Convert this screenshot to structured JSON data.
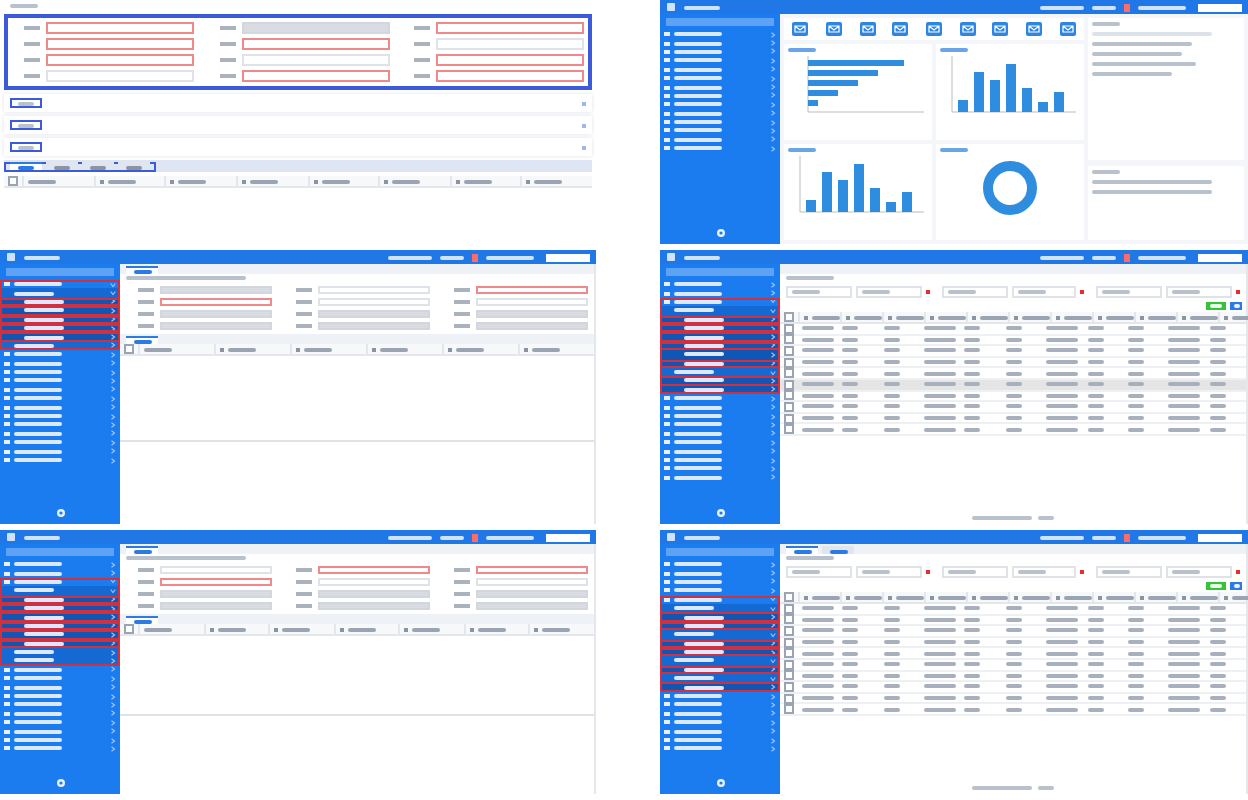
{
  "screens": [
    {
      "kind": "form",
      "fields": [
        {
          "required": true,
          "disabled": false
        },
        {
          "required": false,
          "disabled": true
        },
        {
          "required": true,
          "disabled": false
        },
        {
          "required": true,
          "disabled": false
        },
        {
          "required": true,
          "disabled": false
        },
        {
          "required": false,
          "disabled": false
        },
        {
          "required": true,
          "disabled": false
        },
        {
          "required": false,
          "disabled": false
        },
        {
          "required": true,
          "disabled": false
        },
        {
          "required": false,
          "disabled": false
        },
        {
          "required": true,
          "disabled": false
        },
        {
          "required": true,
          "disabled": false
        }
      ],
      "sections": [
        {
          "marked": true
        },
        {
          "marked": true
        },
        {
          "marked": true
        }
      ],
      "tabs": [
        {
          "selected": true
        },
        {
          "selected": false
        },
        {
          "selected": false
        },
        {
          "selected": false
        }
      ],
      "select_all": {
        "checked": false
      },
      "columns": [
        {
          "filter": false
        },
        {
          "filter": true
        },
        {
          "filter": true
        },
        {
          "filter": true
        },
        {
          "filter": true
        },
        {
          "filter": true
        },
        {
          "filter": true
        },
        {
          "filter": true
        }
      ]
    },
    {
      "kind": "dashboard",
      "sidebar": [
        {
          "expanded": false,
          "marked": false
        },
        {
          "expanded": false,
          "marked": false
        },
        {
          "expanded": false,
          "marked": false
        },
        {
          "expanded": false,
          "marked": false
        },
        {
          "expanded": false,
          "marked": false
        },
        {
          "expanded": false,
          "marked": false
        },
        {
          "expanded": false,
          "marked": false
        },
        {
          "expanded": false,
          "marked": false
        },
        {
          "expanded": false,
          "marked": false
        },
        {
          "expanded": false,
          "marked": false
        },
        {
          "expanded": false,
          "marked": false
        },
        {
          "expanded": false,
          "marked": false
        },
        {
          "expanded": false,
          "marked": false
        },
        {
          "expanded": false,
          "marked": false
        }
      ],
      "shortcuts": [
        {
          "kind": "envelope"
        },
        {
          "kind": "envelope"
        },
        {
          "kind": "envelope"
        },
        {
          "kind": "envelope"
        },
        {
          "kind": "envelope"
        },
        {
          "kind": "envelope"
        },
        {
          "kind": "envelope"
        },
        {
          "kind": "envelope"
        },
        {
          "kind": "envelope"
        }
      ],
      "charts": [
        {
          "kind": "hbar"
        },
        {
          "kind": "bar"
        },
        {
          "kind": "bar"
        },
        {
          "kind": "donut"
        }
      ]
    },
    {
      "kind": "detail",
      "sidebar": [
        {
          "expanded": true,
          "marked": true,
          "children": [
            {
              "expanded": true,
              "marked": false,
              "children": [
                {
                  "expanded": false,
                  "marked": true
                },
                {
                  "expanded": false,
                  "marked": true
                },
                {
                  "expanded": false,
                  "marked": true
                },
                {
                  "expanded": false,
                  "marked": true
                },
                {
                  "expanded": false,
                  "marked": true
                }
              ]
            },
            {
              "expanded": false,
              "marked": false
            }
          ]
        },
        {
          "expanded": false,
          "marked": false
        },
        {
          "expanded": false,
          "marked": false
        },
        {
          "expanded": false,
          "marked": false
        },
        {
          "expanded": false,
          "marked": false
        },
        {
          "expanded": false,
          "marked": false
        },
        {
          "expanded": false,
          "marked": false
        },
        {
          "expanded": false,
          "marked": false
        },
        {
          "expanded": false,
          "marked": false
        },
        {
          "expanded": false,
          "marked": false
        },
        {
          "expanded": false,
          "marked": false
        },
        {
          "expanded": false,
          "marked": false
        },
        {
          "expanded": false,
          "marked": false
        },
        {
          "expanded": false,
          "marked": false
        }
      ],
      "fields": [
        {
          "required": false,
          "disabled": true
        },
        {
          "required": false,
          "disabled": false
        },
        {
          "required": true,
          "disabled": false
        },
        {
          "required": true,
          "disabled": false
        },
        {
          "required": false,
          "disabled": false
        },
        {
          "required": false,
          "disabled": false
        },
        {
          "required": false,
          "disabled": true
        },
        {
          "required": false,
          "disabled": true
        },
        {
          "required": false,
          "disabled": true
        },
        {
          "required": false,
          "disabled": true
        },
        {
          "required": false,
          "disabled": true
        },
        {
          "required": false,
          "disabled": true
        }
      ],
      "tabs": [
        {
          "selected": true
        }
      ],
      "select_all": {
        "checked": false
      },
      "columns": [
        {
          "filter": false
        },
        {
          "filter": true
        },
        {
          "filter": true
        },
        {
          "filter": true
        },
        {
          "filter": true
        },
        {
          "filter": true
        }
      ]
    },
    {
      "kind": "grid",
      "sidebar": [
        {
          "expanded": false,
          "marked": false
        },
        {
          "expanded": false,
          "marked": false
        },
        {
          "expanded": true,
          "marked": true,
          "children": [
            {
              "expanded": true,
              "marked": false,
              "children": [
                {
                  "expanded": false,
                  "marked": true
                },
                {
                  "expanded": false,
                  "marked": true
                },
                {
                  "expanded": false,
                  "marked": true
                },
                {
                  "expanded": false,
                  "marked": true
                },
                {
                  "expanded": false,
                  "marked": false
                },
                {
                  "expanded": false,
                  "marked": true
                }
              ]
            },
            {
              "expanded": true,
              "marked": false,
              "children": [
                {
                  "expanded": false,
                  "marked": true
                },
                {
                  "expanded": false,
                  "marked": false
                }
              ]
            }
          ]
        },
        {
          "expanded": false,
          "marked": false
        },
        {
          "expanded": false,
          "marked": false
        },
        {
          "expanded": false,
          "marked": false
        },
        {
          "expanded": false,
          "marked": false
        },
        {
          "expanded": false,
          "marked": false
        },
        {
          "expanded": false,
          "marked": false
        },
        {
          "expanded": false,
          "marked": false
        },
        {
          "expanded": false,
          "marked": false
        },
        {
          "expanded": false,
          "marked": false
        },
        {
          "expanded": false,
          "marked": false
        }
      ],
      "filters": [
        {
          "required": true
        },
        {
          "required": true
        },
        {
          "required": true
        }
      ],
      "select_all": {
        "checked": false
      },
      "columns": [
        {
          "filter": true
        },
        {
          "filter": true
        },
        {
          "filter": true
        },
        {
          "filter": true
        },
        {
          "filter": true
        },
        {
          "filter": true
        },
        {
          "filter": true
        },
        {
          "filter": true
        },
        {
          "filter": true
        },
        {
          "filter": true
        },
        {
          "filter": true
        }
      ],
      "rows": [
        {
          "selected": false
        },
        {
          "selected": false
        },
        {
          "selected": false
        },
        {
          "selected": false
        },
        {
          "selected": false
        },
        {
          "selected": true
        },
        {
          "selected": false
        },
        {
          "selected": false
        },
        {
          "selected": false
        },
        {
          "selected": false
        }
      ]
    },
    {
      "kind": "detail",
      "sidebar": [
        {
          "expanded": false,
          "marked": false
        },
        {
          "expanded": false,
          "marked": false
        },
        {
          "expanded": true,
          "marked": true,
          "children": [
            {
              "expanded": true,
              "marked": false,
              "children": [
                {
                  "expanded": false,
                  "marked": true
                },
                {
                  "expanded": false,
                  "marked": true
                },
                {
                  "expanded": false,
                  "marked": true
                },
                {
                  "expanded": false,
                  "marked": true
                },
                {
                  "expanded": false,
                  "marked": true
                },
                {
                  "expanded": false,
                  "marked": true
                }
              ]
            },
            {
              "expanded": false,
              "marked": false
            },
            {
              "expanded": false,
              "marked": false
            }
          ]
        },
        {
          "expanded": false,
          "marked": false
        },
        {
          "expanded": false,
          "marked": false
        },
        {
          "expanded": false,
          "marked": false
        },
        {
          "expanded": false,
          "marked": false
        },
        {
          "expanded": false,
          "marked": false
        },
        {
          "expanded": false,
          "marked": false
        },
        {
          "expanded": false,
          "marked": false
        },
        {
          "expanded": false,
          "marked": false
        },
        {
          "expanded": false,
          "marked": false
        },
        {
          "expanded": false,
          "marked": false
        }
      ],
      "fields": [
        {
          "required": false,
          "disabled": false
        },
        {
          "required": true,
          "disabled": false
        },
        {
          "required": true,
          "disabled": false
        },
        {
          "required": true,
          "disabled": false
        },
        {
          "required": false,
          "disabled": false
        },
        {
          "required": false,
          "disabled": false
        },
        {
          "required": false,
          "disabled": true
        },
        {
          "required": false,
          "disabled": true
        },
        {
          "required": false,
          "disabled": true
        },
        {
          "required": false,
          "disabled": true
        },
        {
          "required": false,
          "disabled": true
        },
        {
          "required": false,
          "disabled": true
        }
      ],
      "tabs": [
        {
          "selected": true
        }
      ],
      "select_all": {
        "checked": false
      },
      "columns": [
        {
          "filter": false
        },
        {
          "filter": true
        },
        {
          "filter": true
        },
        {
          "filter": true
        },
        {
          "filter": true
        },
        {
          "filter": true
        },
        {
          "filter": true
        }
      ]
    },
    {
      "kind": "grid",
      "sidebar": [
        {
          "expanded": false,
          "marked": false
        },
        {
          "expanded": false,
          "marked": false
        },
        {
          "expanded": false,
          "marked": false
        },
        {
          "expanded": false,
          "marked": false
        },
        {
          "expanded": true,
          "marked": true,
          "children": [
            {
              "expanded": true,
              "marked": false,
              "children": [
                {
                  "expanded": false,
                  "marked": true
                },
                {
                  "expanded": false,
                  "marked": true
                }
              ]
            },
            {
              "expanded": true,
              "marked": false,
              "children": [
                {
                  "expanded": false,
                  "marked": true
                },
                {
                  "expanded": false,
                  "marked": true
                }
              ]
            },
            {
              "expanded": true,
              "marked": false,
              "children": [
                {
                  "expanded": false,
                  "marked": true
                }
              ]
            },
            {
              "expanded": true,
              "marked": false,
              "children": [
                {
                  "expanded": false,
                  "marked": true
                }
              ]
            }
          ]
        },
        {
          "expanded": false,
          "marked": false
        },
        {
          "expanded": false,
          "marked": false
        },
        {
          "expanded": false,
          "marked": false
        },
        {
          "expanded": false,
          "marked": false
        },
        {
          "expanded": false,
          "marked": false
        },
        {
          "expanded": false,
          "marked": false
        },
        {
          "expanded": false,
          "marked": false
        }
      ],
      "tabs": [
        {
          "selected": true
        },
        {
          "selected": false
        }
      ],
      "filters": [
        {
          "required": true
        },
        {
          "required": true
        },
        {
          "required": true
        }
      ],
      "select_all": {
        "checked": false
      },
      "columns": [
        {
          "filter": true
        },
        {
          "filter": true
        },
        {
          "filter": true
        },
        {
          "filter": true
        },
        {
          "filter": true
        },
        {
          "filter": true
        },
        {
          "filter": true
        },
        {
          "filter": true
        },
        {
          "filter": true
        },
        {
          "filter": true
        },
        {
          "filter": true
        }
      ],
      "rows": [
        {
          "selected": false
        },
        {
          "selected": false
        },
        {
          "selected": false
        },
        {
          "selected": false
        },
        {
          "selected": false
        },
        {
          "selected": false
        },
        {
          "selected": false
        },
        {
          "selected": false
        },
        {
          "selected": false
        },
        {
          "selected": false
        }
      ]
    }
  ]
}
